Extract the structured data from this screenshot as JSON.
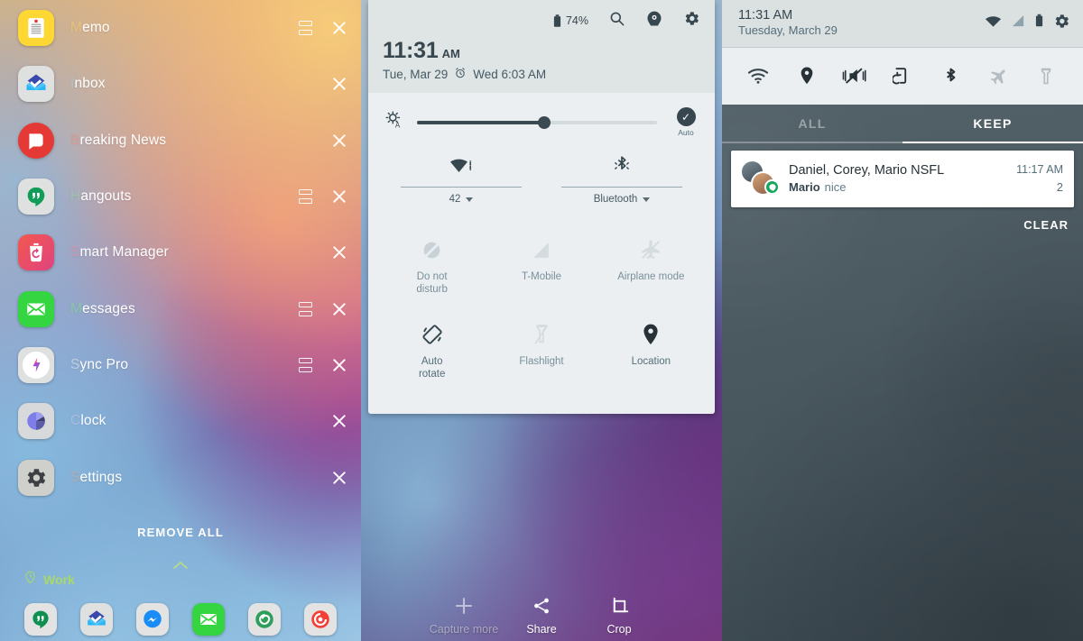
{
  "recents": {
    "apps": [
      {
        "label": "Memo",
        "icon": "memo-icon",
        "split": true
      },
      {
        "label": "Inbox",
        "icon": "inbox-icon",
        "split": false
      },
      {
        "label": "Breaking News",
        "icon": "breaking-news-icon",
        "split": false
      },
      {
        "label": "Hangouts",
        "icon": "hangouts-icon",
        "split": true
      },
      {
        "label": "Smart Manager",
        "icon": "smart-manager-icon",
        "split": false
      },
      {
        "label": "Messages",
        "icon": "messages-icon",
        "split": true
      },
      {
        "label": "Sync Pro",
        "icon": "sync-pro-icon",
        "split": true
      },
      {
        "label": "Clock",
        "icon": "clock-icon",
        "split": false
      },
      {
        "label": "Settings",
        "icon": "settings-icon",
        "split": false
      }
    ],
    "remove_all": "REMOVE ALL",
    "work_label": "Work",
    "dock": [
      "hangouts-icon",
      "inbox-icon",
      "messenger-icon",
      "messages-icon",
      "spiral-icon",
      "pocketcasts-icon"
    ]
  },
  "quick_settings": {
    "battery": "74%",
    "time": "11:31",
    "ampm": "AM",
    "date": "Tue, Mar 29",
    "alarm": "Wed 6:03 AM",
    "brightness_auto": "Auto",
    "brightness_value": 53,
    "toggles": [
      {
        "label": "42",
        "icon": "wifi-icon"
      },
      {
        "label": "Bluetooth",
        "icon": "bluetooth-icon"
      }
    ],
    "tiles": [
      {
        "label": "Do not\ndisturb",
        "icon": "do-not-disturb-icon",
        "on": false
      },
      {
        "label": "T-Mobile",
        "icon": "mobile-data-icon",
        "on": false
      },
      {
        "label": "Airplane mode",
        "icon": "airplane-mode-icon",
        "on": false
      },
      {
        "label": "Auto\nrotate",
        "icon": "auto-rotate-icon",
        "on": true
      },
      {
        "label": "Flashlight",
        "icon": "flashlight-icon",
        "on": false
      },
      {
        "label": "Location",
        "icon": "location-icon",
        "on": true
      }
    ],
    "header_icons": [
      "search-icon",
      "quick-connect-icon",
      "gear-icon"
    ],
    "capture": [
      {
        "label": "Capture more",
        "icon": "plus-icon",
        "dim": true
      },
      {
        "label": "Share",
        "icon": "share-icon",
        "dim": false
      },
      {
        "label": "Crop",
        "icon": "crop-icon",
        "dim": false
      }
    ]
  },
  "notifications": {
    "time": "11:31 AM",
    "date": "Tuesday, March 29",
    "status_icons": [
      "wifi-icon",
      "signal-icon",
      "battery-icon",
      "gear-icon"
    ],
    "quick_icons": [
      {
        "icon": "wifi-icon",
        "on": true
      },
      {
        "icon": "location-icon",
        "on": true
      },
      {
        "icon": "vibrate-mute-icon",
        "on": true
      },
      {
        "icon": "screen-rotate-icon",
        "on": true
      },
      {
        "icon": "bluetooth-icon",
        "on": true
      },
      {
        "icon": "airplane-icon",
        "on": false
      },
      {
        "icon": "flashlight-icon",
        "on": false
      }
    ],
    "tabs": [
      {
        "label": "ALL",
        "active": false
      },
      {
        "label": "KEEP",
        "active": true
      }
    ],
    "items": [
      {
        "title": "Daniel, Corey, Mario NSFL",
        "sender": "Mario",
        "message": "nice",
        "time": "11:17 AM",
        "count": "2"
      }
    ],
    "clear": "CLEAR"
  },
  "colors": {
    "accent_green": "#a8d86a",
    "card_bg": "#eceff1",
    "header_bg": "#dfe4e5",
    "text_dark": "#37474f",
    "badge_green": "#17a65b"
  }
}
